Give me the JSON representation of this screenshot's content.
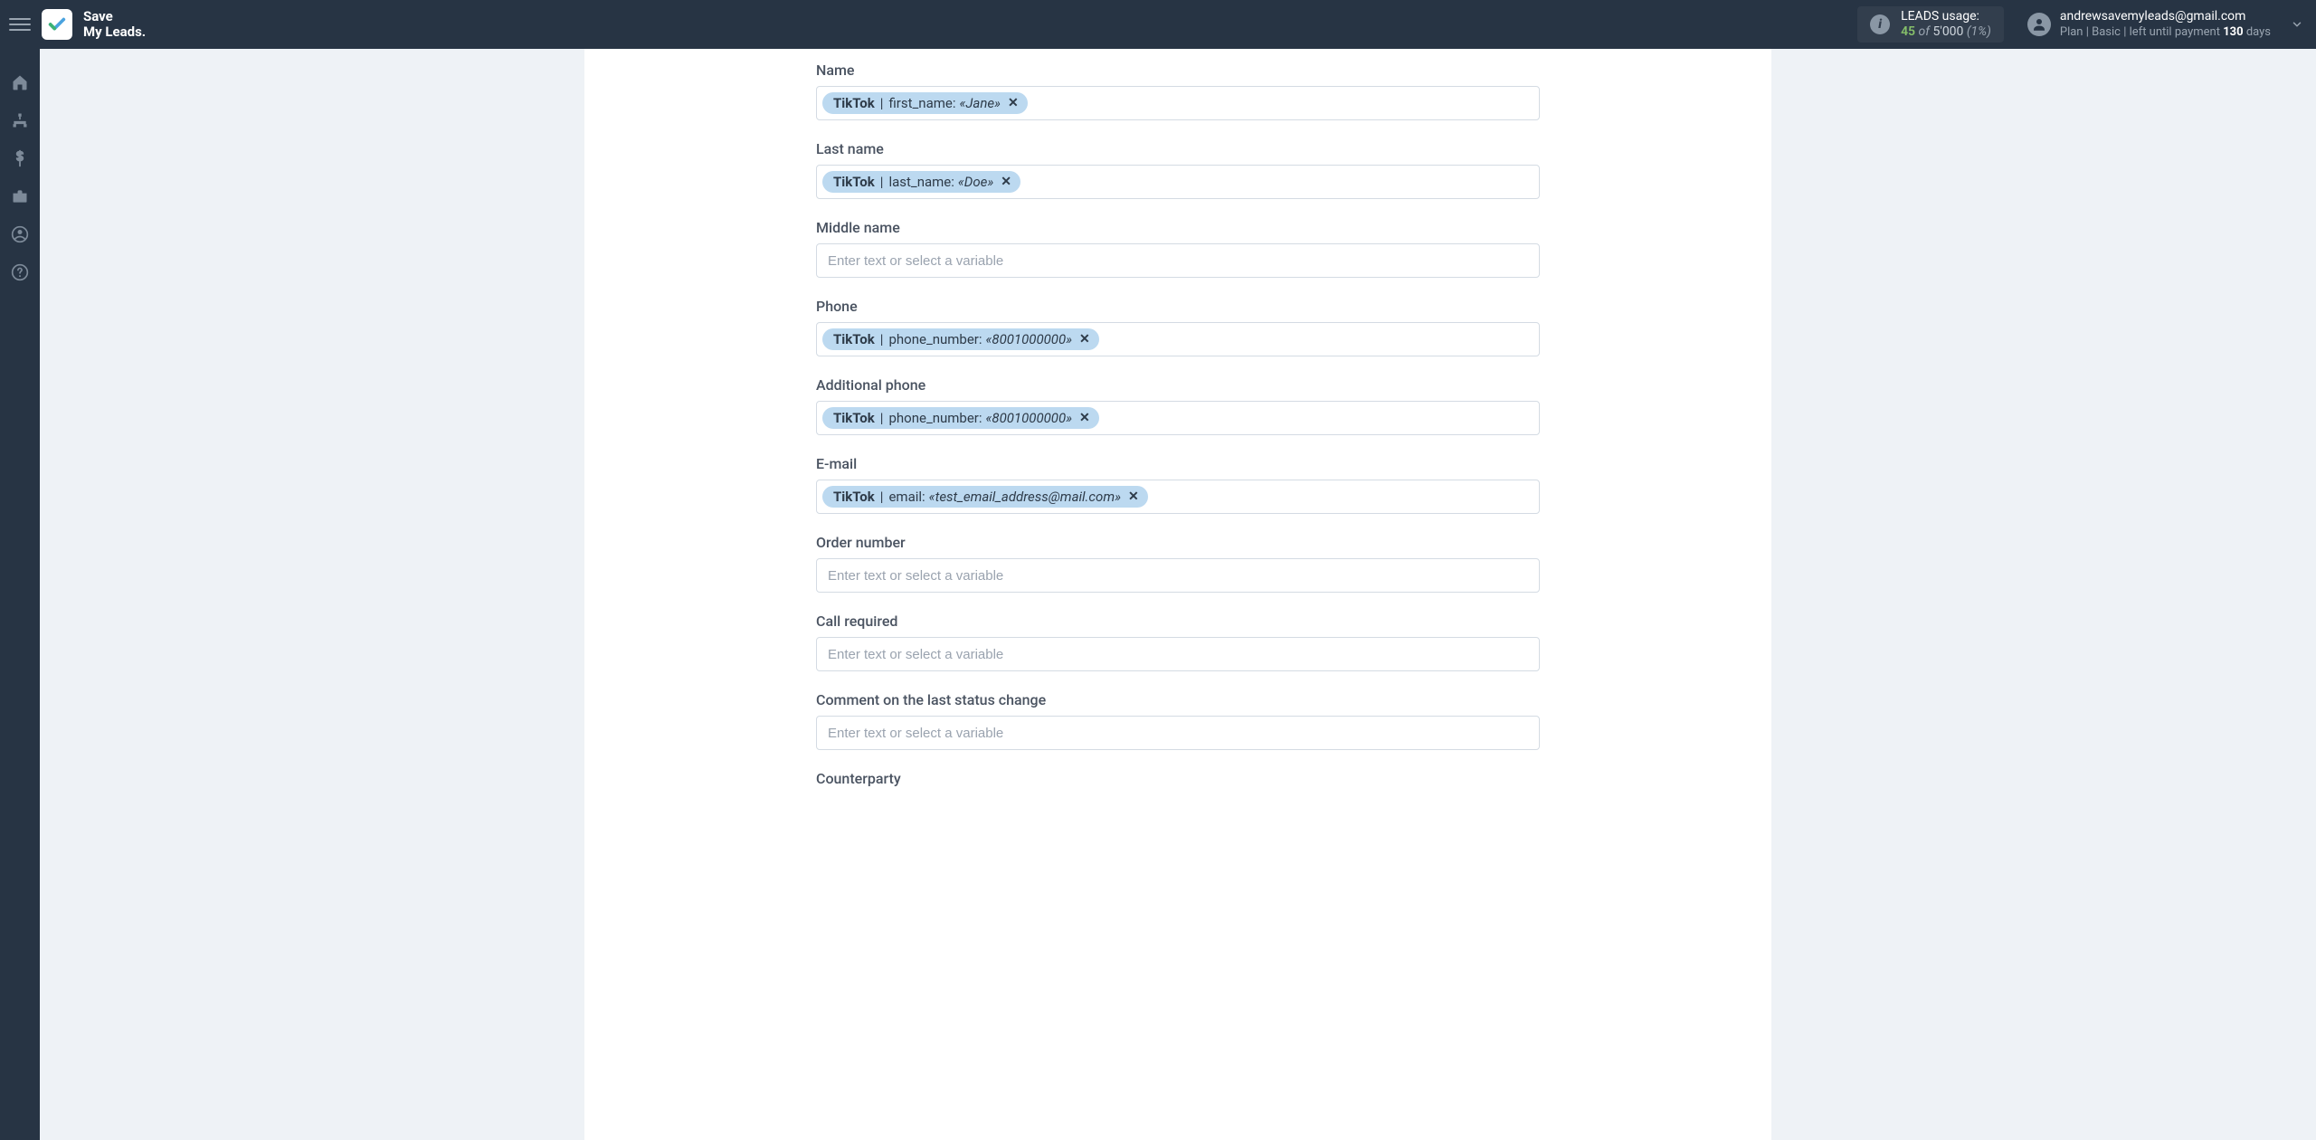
{
  "brand": {
    "line1": "Save",
    "line2": "My Leads."
  },
  "usage": {
    "title": "LEADS usage:",
    "count": "45",
    "of": "of",
    "total": "5'000",
    "pct": "(1%)"
  },
  "account": {
    "email": "andrewsavemyleads@gmail.com",
    "plan_prefix": "Plan |",
    "plan_name": "Basic",
    "plan_mid": "| left until payment",
    "days": "130",
    "days_suffix": "days"
  },
  "placeholder": "Enter text or select a variable",
  "fields": [
    {
      "label": "Name",
      "token": {
        "source": "TikTok",
        "key": "first_name",
        "value": "«Jane»"
      }
    },
    {
      "label": "Last name",
      "token": {
        "source": "TikTok",
        "key": "last_name",
        "value": "«Doe»"
      }
    },
    {
      "label": "Middle name",
      "token": null
    },
    {
      "label": "Phone",
      "token": {
        "source": "TikTok",
        "key": "phone_number",
        "value": "«8001000000»"
      }
    },
    {
      "label": "Additional phone",
      "token": {
        "source": "TikTok",
        "key": "phone_number",
        "value": "«8001000000»"
      }
    },
    {
      "label": "E-mail",
      "token": {
        "source": "TikTok",
        "key": "email",
        "value": "«test_email_address@mail.com»"
      }
    },
    {
      "label": "Order number",
      "token": null
    },
    {
      "label": "Call required",
      "token": null
    },
    {
      "label": "Comment on the last status change",
      "token": null
    },
    {
      "label": "Counterparty",
      "token": null,
      "partial": true
    }
  ]
}
